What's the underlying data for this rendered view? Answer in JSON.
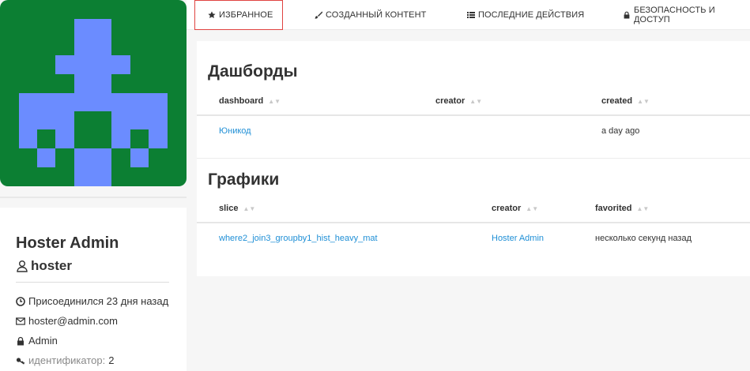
{
  "tabs": [
    {
      "label": "ИЗБРАННОЕ",
      "icon": "star-icon",
      "active": true
    },
    {
      "label": "СОЗДАННЫЙ КОНТЕНТ",
      "icon": "paintbrush-icon",
      "active": false
    },
    {
      "label": "ПОСЛЕДНИЕ ДЕЙСТВИЯ",
      "icon": "list-icon",
      "active": false
    },
    {
      "label": "БЕЗОПАСНОСТЬ И ДОСТУП",
      "icon": "lock-icon",
      "active": false
    }
  ],
  "profile": {
    "avatar_bg": "#0c7f33",
    "avatar_fg": "#6b8cff",
    "name": "Hoster Admin",
    "username": "hoster",
    "joined": "Присоединился 23 дня назад",
    "email": "hoster@admin.com",
    "role": "Admin",
    "id_label": "идентификатор:",
    "id_value": "2"
  },
  "dashboards": {
    "title": "Дашборды",
    "columns": [
      "dashboard",
      "creator",
      "created"
    ],
    "rows": [
      {
        "dashboard": "Юникод",
        "creator": "",
        "created": "a day ago"
      }
    ]
  },
  "charts": {
    "title": "Графики",
    "columns": [
      "slice",
      "creator",
      "favorited"
    ],
    "rows": [
      {
        "slice": "where2_join3_groupby1_hist_heavy_mat",
        "creator": "Hoster Admin",
        "favorited": "несколько секунд назад"
      }
    ]
  },
  "colors": {
    "link": "#1f8fd6",
    "active_tab_border": "#e04341"
  }
}
